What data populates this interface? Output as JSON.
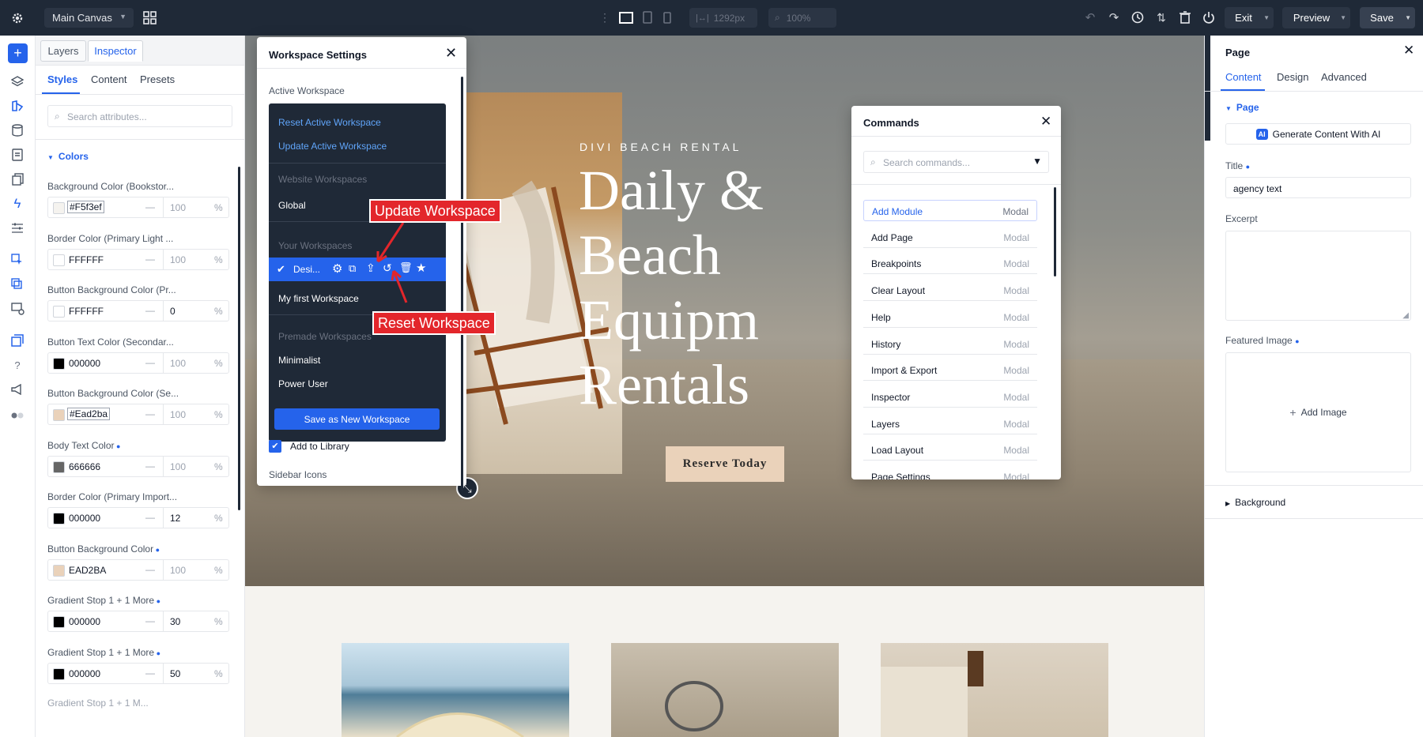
{
  "topbar": {
    "canvas_name": "Main Canvas",
    "width_value": "1292px",
    "zoom_value": "100%",
    "exit_label": "Exit",
    "preview_label": "Preview",
    "save_label": "Save"
  },
  "left_panel": {
    "top_tabs": [
      "Layers",
      "Inspector"
    ],
    "sub_tabs": [
      "Styles",
      "Content",
      "Presets"
    ],
    "search_placeholder": "Search attributes...",
    "section_title": "Colors",
    "fields": [
      {
        "label": "Background Color (Bookstor...",
        "value": "#F5f3ef",
        "opacity": "100",
        "swatch": "#f5f3ef",
        "dot": false,
        "highlight": true
      },
      {
        "label": "Border Color (Primary Light ...",
        "value": "FFFFFF",
        "opacity": "100",
        "swatch": "#ffffff",
        "dot": false,
        "highlight": false
      },
      {
        "label": "Button Background Color (Pr...",
        "value": "FFFFFF",
        "opacity": "0",
        "swatch": "#ffffff",
        "dot": false,
        "highlight": false
      },
      {
        "label": "Button Text Color (Secondar...",
        "value": "000000",
        "opacity": "100",
        "swatch": "#000000",
        "dot": false,
        "highlight": false
      },
      {
        "label": "Button Background Color (Se...",
        "value": "#Ead2ba",
        "opacity": "100",
        "swatch": "#ead2ba",
        "dot": false,
        "highlight": true
      },
      {
        "label": "Body Text Color",
        "value": "666666",
        "opacity": "100",
        "swatch": "#666666",
        "dot": true,
        "highlight": false
      },
      {
        "label": "Border Color (Primary Import...",
        "value": "000000",
        "opacity": "12",
        "swatch": "#000000",
        "dot": false,
        "highlight": false
      },
      {
        "label": "Button Background Color",
        "value": "EAD2BA",
        "opacity": "100",
        "swatch": "#ead2ba",
        "dot": true,
        "highlight": false
      },
      {
        "label": "Gradient Stop 1 + 1 More",
        "value": "000000",
        "opacity": "30",
        "swatch": "#000000",
        "dot": true,
        "highlight": false
      },
      {
        "label": "Gradient Stop 1 + 1 More",
        "value": "000000",
        "opacity": "50",
        "swatch": "#000000",
        "dot": true,
        "highlight": false
      }
    ]
  },
  "workspace_modal": {
    "title": "Workspace Settings",
    "active_label": "Active Workspace",
    "reset_active": "Reset Active Workspace",
    "update_active": "Update Active Workspace",
    "website_label": "Website Workspaces",
    "global": "Global",
    "your_label": "Your Workspaces",
    "current_item": "Desi...",
    "my_first": "My first Workspace",
    "premade_label": "Premade Workspaces",
    "minimalist": "Minimalist",
    "power_user": "Power User",
    "save_new": "Save as New Workspace",
    "add_library": "Add to Library",
    "sidebar_icons": "Sidebar Icons"
  },
  "callouts": {
    "update": "Update Workspace",
    "reset": "Reset Workspace"
  },
  "hero": {
    "eyebrow": "DIVI BEACH RENTAL",
    "headline_lines": [
      "Daily &",
      "Beach",
      "Equipm",
      "Rentals"
    ],
    "cta": "Reserve Today"
  },
  "commands_modal": {
    "title": "Commands",
    "search_placeholder": "Search commands...",
    "rows": [
      {
        "name": "Add Module",
        "type": "Modal",
        "active": true
      },
      {
        "name": "Add Page",
        "type": "Modal",
        "active": false
      },
      {
        "name": "Breakpoints",
        "type": "Modal",
        "active": false
      },
      {
        "name": "Clear Layout",
        "type": "Modal",
        "active": false
      },
      {
        "name": "Help",
        "type": "Modal",
        "active": false
      },
      {
        "name": "History",
        "type": "Modal",
        "active": false
      },
      {
        "name": "Import & Export",
        "type": "Modal",
        "active": false
      },
      {
        "name": "Inspector",
        "type": "Modal",
        "active": false
      },
      {
        "name": "Layers",
        "type": "Modal",
        "active": false
      },
      {
        "name": "Load Layout",
        "type": "Modal",
        "active": false
      },
      {
        "name": "Page Settings",
        "type": "Modal",
        "active": false
      }
    ]
  },
  "right_panel": {
    "title": "Page",
    "tabs": [
      "Content",
      "Design",
      "Advanced"
    ],
    "section": "Page",
    "ai_button": "Generate Content With AI",
    "ai_badge": "AI",
    "title_label": "Title",
    "title_value": "agency text",
    "excerpt_label": "Excerpt",
    "featured_label": "Featured Image",
    "add_image": "Add Image",
    "background_label": "Background"
  },
  "colors": {
    "accent": "#2563eb",
    "dark": "#1f2937",
    "callout": "#e3262b",
    "cta_bg": "#ead2ba"
  }
}
